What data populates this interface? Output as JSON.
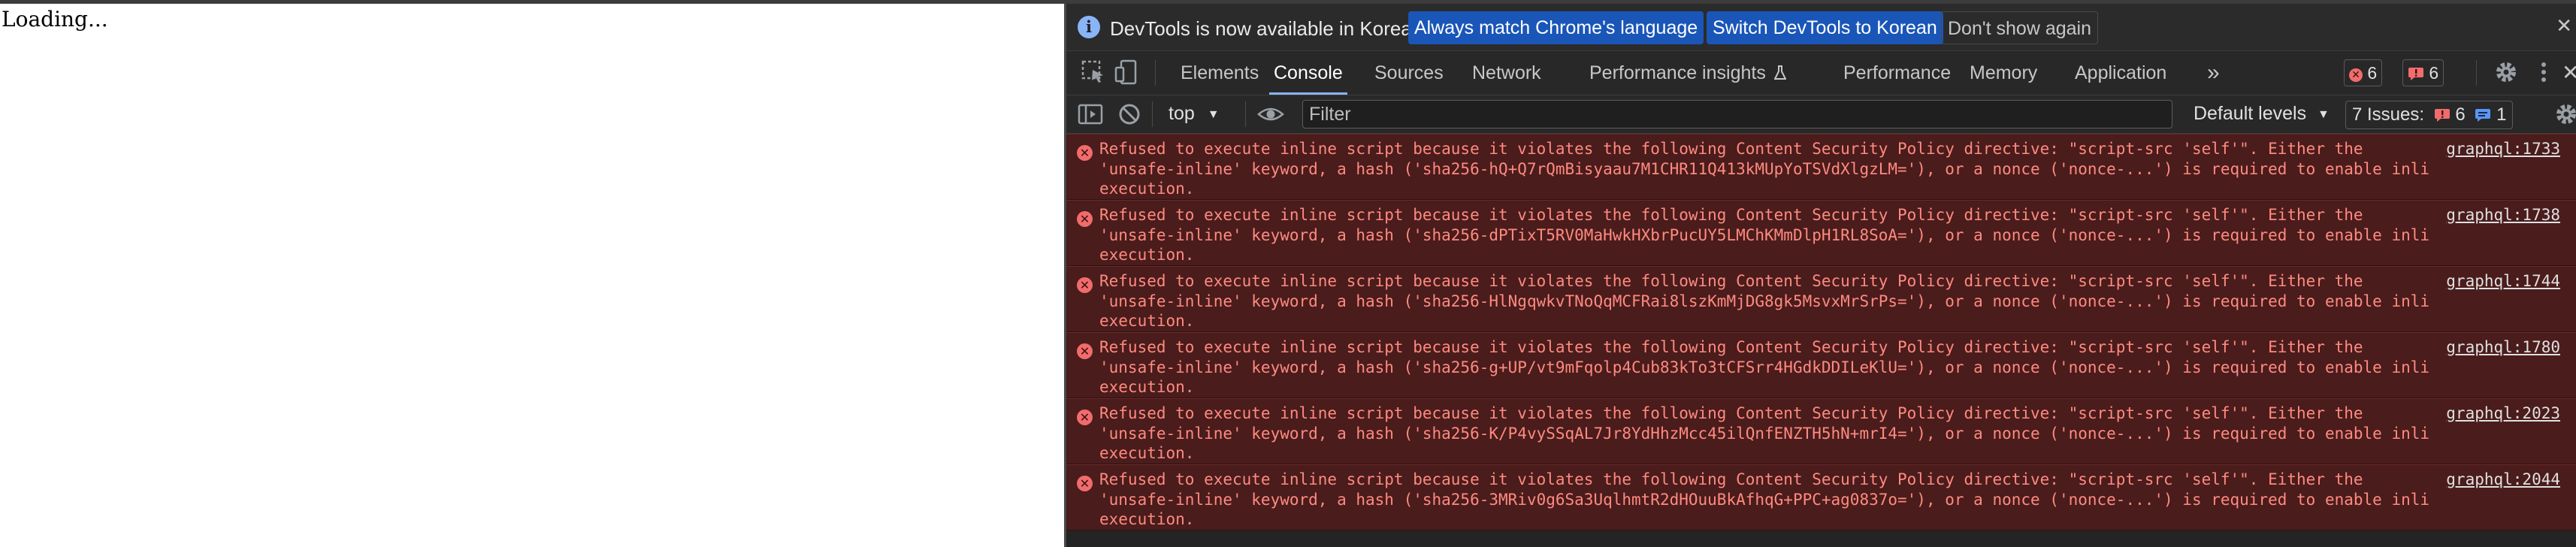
{
  "page": {
    "loading_text": "Loading..."
  },
  "infobar": {
    "message": "DevTools is now available in Korean!",
    "buttons": [
      "Always match Chrome's language",
      "Switch DevTools to Korean",
      "Don't show again"
    ]
  },
  "tabs": [
    "Elements",
    "Console",
    "Sources",
    "Network",
    "Performance insights",
    "Performance",
    "Memory",
    "Application"
  ],
  "active_tab": "Console",
  "more_tabs": "»",
  "counters": {
    "errors": "6",
    "warnings": "6"
  },
  "console_toolbar": {
    "context": "top",
    "filter_placeholder": "Filter",
    "levels": "Default levels",
    "issues_label": "7 Issues:",
    "issues_errors": "6",
    "issues_info": "1"
  },
  "colors": {
    "error_bg": "#4a1c1c",
    "error_text": "#ff8a80",
    "accent": "#8ab4f8",
    "primary_button": "#1a56b8"
  },
  "messages": [
    {
      "source": "graphql:1733",
      "lines": [
        "Refused to execute inline script because it violates the following Content Security Policy directive: \"script-src 'self'\". Either the",
        "'unsafe-inline' keyword, a hash ('sha256-hQ+Q7rQmBisyaau7M1CHR11Q413kMUpYoTSVdXlgzLM='), or a nonce ('nonce-...') is required to enable inline",
        "execution."
      ]
    },
    {
      "source": "graphql:1738",
      "lines": [
        "Refused to execute inline script because it violates the following Content Security Policy directive: \"script-src 'self'\". Either the",
        "'unsafe-inline' keyword, a hash ('sha256-dPTixT5RV0MaHwkHXbrPucUY5LMChKMmDlpH1RL8SoA='), or a nonce ('nonce-...') is required to enable inline",
        "execution."
      ]
    },
    {
      "source": "graphql:1744",
      "lines": [
        "Refused to execute inline script because it violates the following Content Security Policy directive: \"script-src 'self'\". Either the",
        "'unsafe-inline' keyword, a hash ('sha256-HlNgqwkvTNoQqMCFRai8lszKmMjDG8gk5MsvxMrSrPs='), or a nonce ('nonce-...') is required to enable inline",
        "execution."
      ]
    },
    {
      "source": "graphql:1780",
      "lines": [
        "Refused to execute inline script because it violates the following Content Security Policy directive: \"script-src 'self'\". Either the",
        "'unsafe-inline' keyword, a hash ('sha256-g+UP/vt9mFqolp4Cub83kTo3tCFSrr4HGdkDDILeKlU='), or a nonce ('nonce-...') is required to enable inline",
        "execution."
      ]
    },
    {
      "source": "graphql:2023",
      "lines": [
        "Refused to execute inline script because it violates the following Content Security Policy directive: \"script-src 'self'\". Either the",
        "'unsafe-inline' keyword, a hash ('sha256-K/P4vySSqAL7Jr8YdHhzMcc45ilQnfENZTH5hN+mrI4='), or a nonce ('nonce-...') is required to enable inline",
        "execution."
      ]
    },
    {
      "source": "graphql:2044",
      "lines": [
        "Refused to execute inline script because it violates the following Content Security Policy directive: \"script-src 'self'\". Either the",
        "'unsafe-inline' keyword, a hash ('sha256-3MRiv0g6Sa3UqlhmtR2dHOuuBkAfhqG+PPC+ag0837o='), or a nonce ('nonce-...') is required to enable inline",
        "execution."
      ]
    }
  ]
}
